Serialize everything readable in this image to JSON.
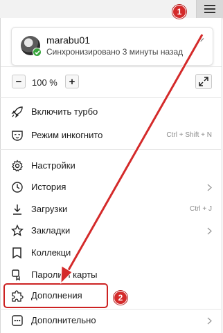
{
  "profile": {
    "username": "marabu01",
    "sync_status": "Синхронизировано 3 минуты назад"
  },
  "zoom": {
    "minus_label": "−",
    "value": "100 %",
    "plus_label": "+"
  },
  "menu": {
    "turbo": {
      "label": "Включить турбо"
    },
    "incognito": {
      "label": "Режим инкогнито",
      "shortcut": "Ctrl + Shift + N"
    },
    "settings": {
      "label": "Настройки"
    },
    "history": {
      "label": "История"
    },
    "downloads": {
      "label": "Загрузки",
      "shortcut": "Ctrl + J"
    },
    "bookmarks": {
      "label": "Закладки"
    },
    "collections": {
      "label": "Коллекци"
    },
    "passwords": {
      "label": "Пароли и карты"
    },
    "extensions": {
      "label": "Дополнения"
    },
    "more": {
      "label": "Дополнительно"
    }
  },
  "annotations": {
    "step1": "1",
    "step2": "2"
  },
  "colors": {
    "annotation_red": "#d42a2a",
    "sync_green": "#37a63c"
  }
}
